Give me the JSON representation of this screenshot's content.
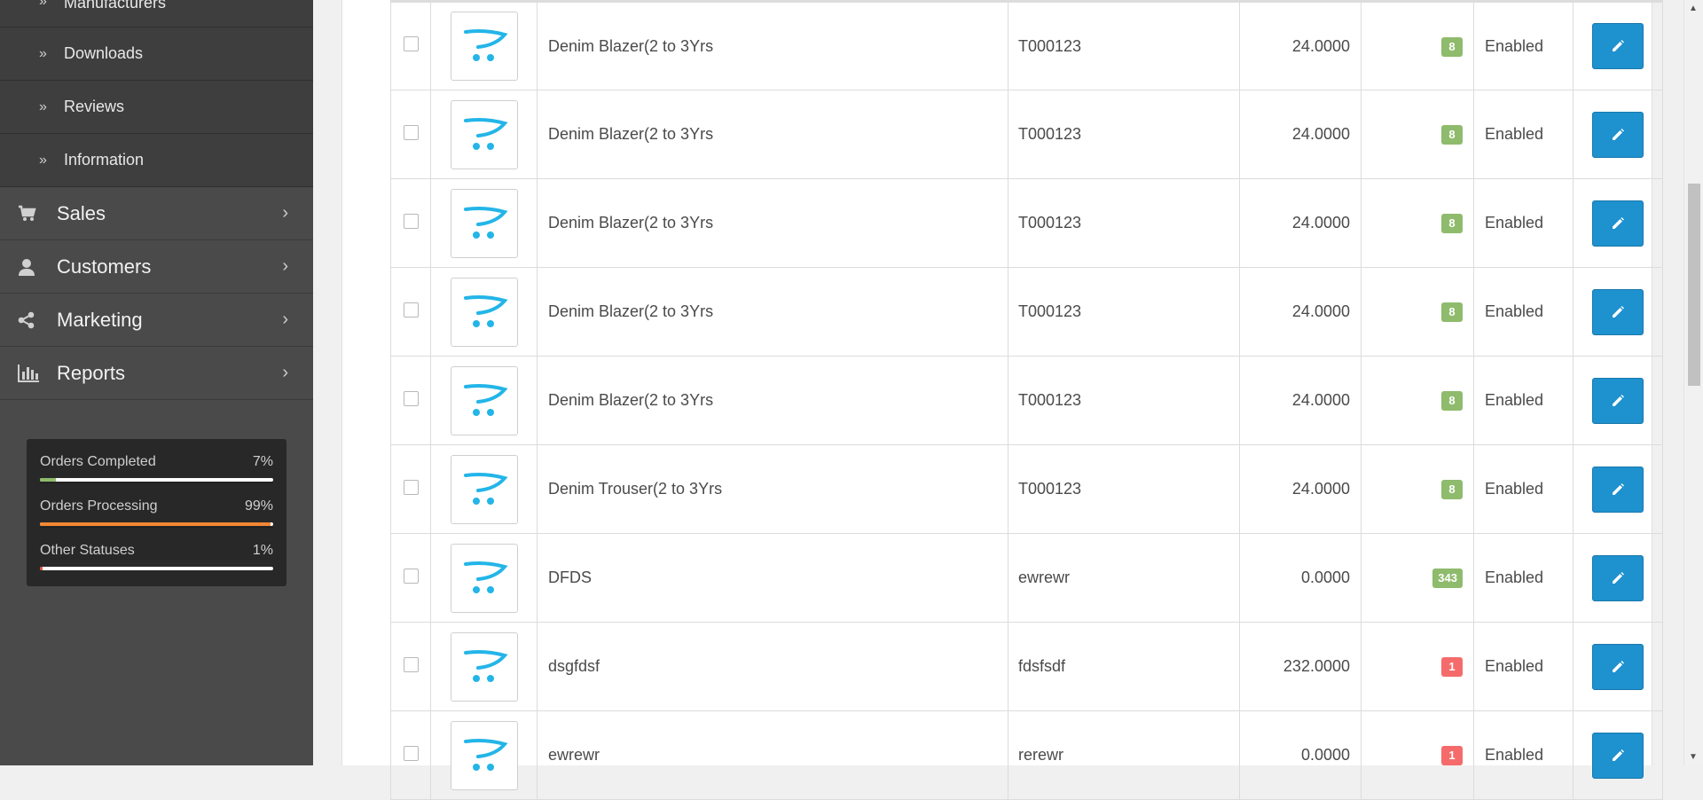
{
  "sidebar": {
    "sub_items": [
      {
        "label": "Manufacturers"
      },
      {
        "label": "Downloads"
      },
      {
        "label": "Reviews"
      },
      {
        "label": "Information"
      }
    ],
    "main_items": [
      {
        "label": "Sales",
        "icon": "cart-icon"
      },
      {
        "label": "Customers",
        "icon": "user-icon"
      },
      {
        "label": "Marketing",
        "icon": "share-icon"
      },
      {
        "label": "Reports",
        "icon": "bar-chart-icon"
      }
    ],
    "stats": [
      {
        "label": "Orders Completed",
        "value": "7%",
        "percent": 7,
        "color": "#8fbb6c"
      },
      {
        "label": "Orders Processing",
        "value": "99%",
        "percent": 99,
        "color": "#f38733"
      },
      {
        "label": "Other Statuses",
        "value": "1%",
        "percent": 1,
        "color": "#e3503e"
      }
    ]
  },
  "products": {
    "rows": [
      {
        "name": "Denim Blazer(2 to 3Yrs",
        "model": "T000123",
        "price": "24.0000",
        "quantity": "8",
        "qty_color": "#8fbb6c",
        "status": "Enabled"
      },
      {
        "name": "Denim Blazer(2 to 3Yrs",
        "model": "T000123",
        "price": "24.0000",
        "quantity": "8",
        "qty_color": "#8fbb6c",
        "status": "Enabled"
      },
      {
        "name": "Denim Blazer(2 to 3Yrs",
        "model": "T000123",
        "price": "24.0000",
        "quantity": "8",
        "qty_color": "#8fbb6c",
        "status": "Enabled"
      },
      {
        "name": "Denim Blazer(2 to 3Yrs",
        "model": "T000123",
        "price": "24.0000",
        "quantity": "8",
        "qty_color": "#8fbb6c",
        "status": "Enabled"
      },
      {
        "name": "Denim Blazer(2 to 3Yrs",
        "model": "T000123",
        "price": "24.0000",
        "quantity": "8",
        "qty_color": "#8fbb6c",
        "status": "Enabled"
      },
      {
        "name": "Denim Trouser(2 to 3Yrs",
        "model": "T000123",
        "price": "24.0000",
        "quantity": "8",
        "qty_color": "#8fbb6c",
        "status": "Enabled"
      },
      {
        "name": "DFDS",
        "model": "ewrewr",
        "price": "0.0000",
        "quantity": "343",
        "qty_color": "#8fbb6c",
        "status": "Enabled"
      },
      {
        "name": "dsgfdsf",
        "model": "fdsfsdf",
        "price": "232.0000",
        "quantity": "1",
        "qty_color": "#f56b6b",
        "status": "Enabled"
      },
      {
        "name": "ewrewr",
        "model": "rerewr",
        "price": "0.0000",
        "quantity": "1",
        "qty_color": "#f56b6b",
        "status": "Enabled"
      }
    ]
  },
  "colors": {
    "accent": "#1e91cf",
    "sidebar_bg": "#4a4a4a"
  }
}
